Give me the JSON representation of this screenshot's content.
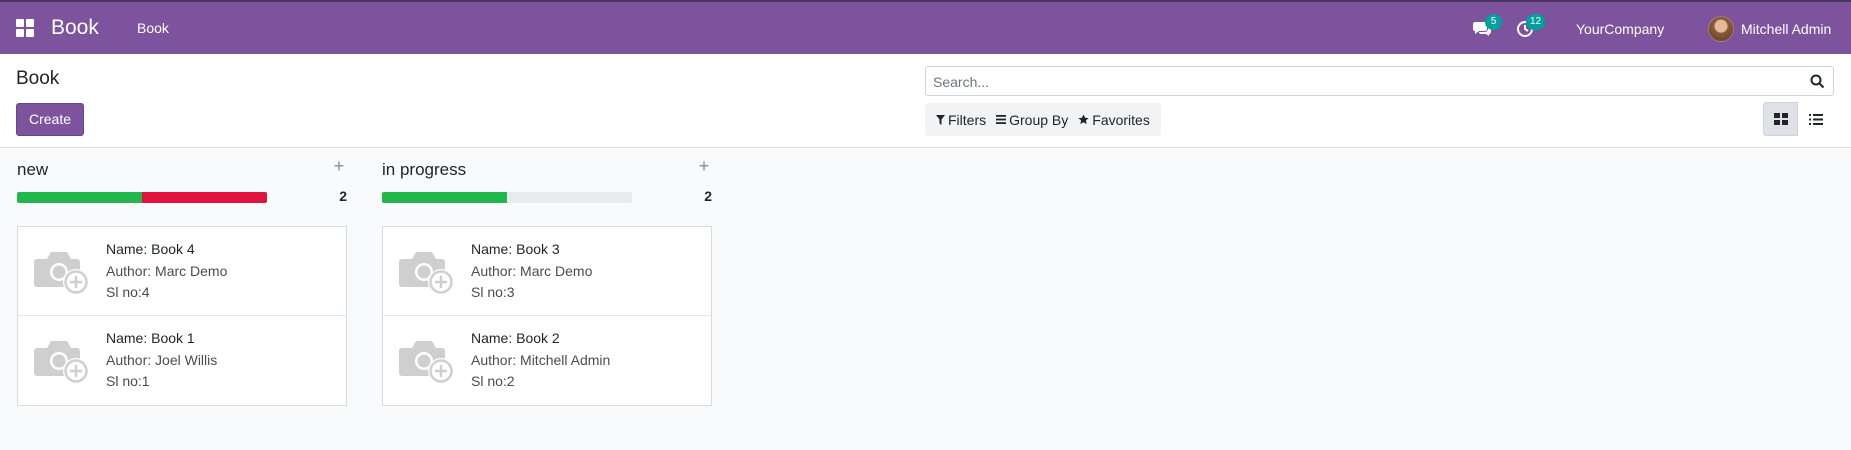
{
  "navbar": {
    "brand": "Book",
    "menu_item": "Book",
    "messages_badge": "5",
    "activities_badge": "12",
    "company": "YourCompany",
    "user": "Mitchell Admin"
  },
  "control_panel": {
    "title": "Book",
    "create_label": "Create",
    "search_placeholder": "Search...",
    "filters_label": "Filters",
    "groupby_label": "Group By",
    "favorites_label": "Favorites"
  },
  "colors": {
    "brand": "#7c539c",
    "badge": "#00a09d",
    "progress_green": "#21b84b",
    "progress_red": "#e0123f"
  },
  "columns": [
    {
      "title": "new",
      "count": "2",
      "progress": [
        {
          "status": "green",
          "fraction": 0.5
        },
        {
          "status": "red",
          "fraction": 0.5
        }
      ],
      "cards": [
        {
          "name": "Name: Book 4",
          "author": "Author: Marc Demo",
          "sl": "Sl no:4"
        },
        {
          "name": "Name: Book 1",
          "author": "Author: Joel Willis",
          "sl": "Sl no:1"
        }
      ]
    },
    {
      "title": "in progress",
      "count": "2",
      "progress": [
        {
          "status": "green",
          "fraction": 0.5
        }
      ],
      "cards": [
        {
          "name": "Name: Book 3",
          "author": "Author: Marc Demo",
          "sl": "Sl no:3"
        },
        {
          "name": "Name: Book 2",
          "author": "Author: Mitchell Admin",
          "sl": "Sl no:2"
        }
      ]
    }
  ]
}
